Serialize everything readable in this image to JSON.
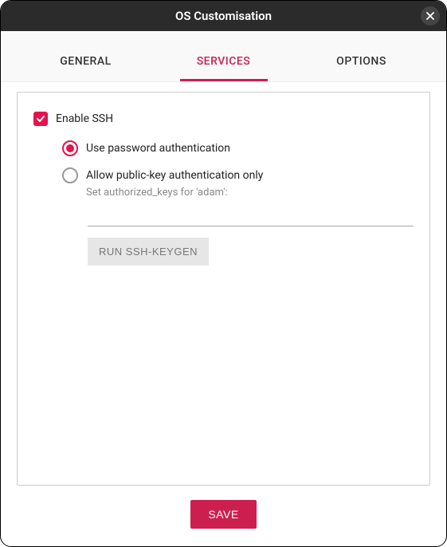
{
  "window": {
    "title": "OS Customisation"
  },
  "tabs": {
    "general": "GENERAL",
    "services": "SERVICES",
    "options": "OPTIONS",
    "active": "services"
  },
  "ssh": {
    "enable_label": "Enable SSH",
    "enabled": true,
    "auth_mode": "password",
    "password_label": "Use password authentication",
    "pubkey_label": "Allow public-key authentication only",
    "authorized_keys_hint": "Set authorized_keys for 'adam':",
    "authorized_keys_value": "",
    "keygen_button": "RUN SSH-KEYGEN"
  },
  "footer": {
    "save_label": "SAVE"
  },
  "colors": {
    "accent": "#cc1f4f",
    "checkbox": "#e5134b"
  }
}
